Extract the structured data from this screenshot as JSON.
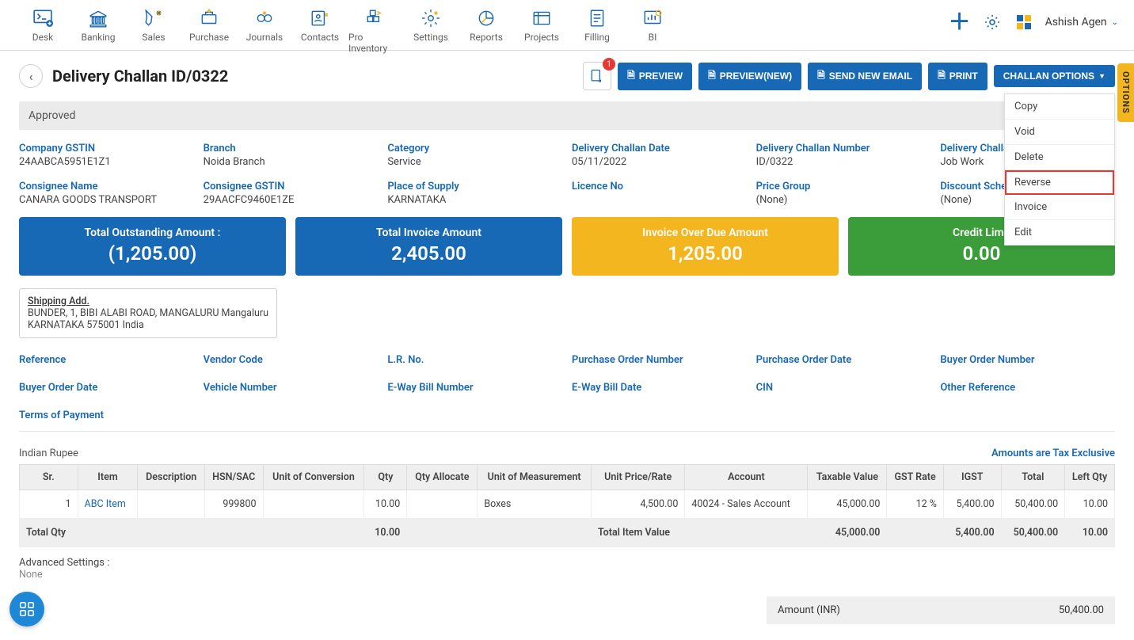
{
  "nav": {
    "items": [
      {
        "label": "Desk"
      },
      {
        "label": "Banking"
      },
      {
        "label": "Sales"
      },
      {
        "label": "Purchase"
      },
      {
        "label": "Journals"
      },
      {
        "label": "Contacts"
      },
      {
        "label": "Pro Inventory"
      },
      {
        "label": "Settings"
      },
      {
        "label": "Reports"
      },
      {
        "label": "Projects"
      },
      {
        "label": "Filling"
      },
      {
        "label": "BI"
      }
    ],
    "user": "Ashish Agen"
  },
  "header": {
    "title": "Delivery Challan ID/0322",
    "badge": "1",
    "actions": {
      "preview": "PREVIEW",
      "preview_new": "PREVIEW(NEW)",
      "send_email": "SEND NEW EMAIL",
      "print": "PRINT",
      "challan_options": "CHALLAN OPTIONS"
    },
    "options_menu": [
      "Copy",
      "Void",
      "Delete",
      "Reverse",
      "Invoice",
      "Edit"
    ],
    "status": "Approved"
  },
  "fields_top": [
    {
      "label": "Company GSTIN",
      "value": "24AABCA5951E1Z1"
    },
    {
      "label": "Branch",
      "value": "Noida Branch"
    },
    {
      "label": "Category",
      "value": "Service"
    },
    {
      "label": "Delivery Challan Date",
      "value": "05/11/2022"
    },
    {
      "label": "Delivery Challan Number",
      "value": "ID/0322"
    },
    {
      "label": "Delivery Challa",
      "value": "Job Work"
    },
    {
      "label": "Consignee Name",
      "value": "CANARA GOODS TRANSPORT"
    },
    {
      "label": "Consignee GSTIN",
      "value": "29AACFC9460E1ZE"
    },
    {
      "label": "Place of Supply",
      "value": "KARNATAKA"
    },
    {
      "label": "Licence No",
      "value": ""
    },
    {
      "label": "Price Group",
      "value": "(None)"
    },
    {
      "label": "Discount Sche",
      "value": "(None)"
    }
  ],
  "summary": [
    {
      "label": "Total Outstanding Amount :",
      "value": "(1,205.00)",
      "cls": "c-blue"
    },
    {
      "label": "Total Invoice Amount",
      "value": "2,405.00",
      "cls": "c-blue"
    },
    {
      "label": "Invoice Over Due Amount",
      "value": "1,205.00",
      "cls": "c-yellow"
    },
    {
      "label": "Credit Limit",
      "value": "0.00",
      "cls": "c-green"
    }
  ],
  "shipping": {
    "heading": "Shipping Add.",
    "line1": "BUNDER, 1, BIBI ALABI ROAD, MANGALURU Mangaluru",
    "line2": "KARNATAKA 575001 India"
  },
  "fields_mid": [
    {
      "label": "Reference"
    },
    {
      "label": "Vendor Code"
    },
    {
      "label": "L.R. No."
    },
    {
      "label": "Purchase Order Number"
    },
    {
      "label": "Purchase Order Date"
    },
    {
      "label": "Buyer Order Number"
    },
    {
      "label": "Buyer Order Date"
    },
    {
      "label": "Vehicle Number"
    },
    {
      "label": "E-Way Bill Number"
    },
    {
      "label": "E-Way Bill Date"
    },
    {
      "label": "CIN"
    },
    {
      "label": "Other Reference"
    },
    {
      "label": "Terms of Payment"
    }
  ],
  "currency": "Indian Rupee",
  "tax_note": "Amounts are Tax Exclusive",
  "table": {
    "headers": [
      "Sr.",
      "Item",
      "Description",
      "HSN/SAC",
      "Unit of Conversion",
      "Qty",
      "Qty Allocate",
      "Unit of Measurement",
      "Unit Price/Rate",
      "Account",
      "Taxable Value",
      "GST Rate",
      "IGST",
      "Total",
      "Left Qty"
    ],
    "row": {
      "sr": "1",
      "item": "ABC Item",
      "desc": "",
      "hsn": "999800",
      "uoc": "",
      "qty": "10.00",
      "qalloc": "",
      "uom": "Boxes",
      "rate": "4,500.00",
      "account": "40024 - Sales Account",
      "taxable": "45,000.00",
      "gstrate": "12 %",
      "igst": "5,400.00",
      "total": "50,400.00",
      "left": "10.00"
    },
    "footer": {
      "label": "Total Qty",
      "qty": "10.00",
      "ratelabel": "Total Item Value",
      "taxable": "45,000.00",
      "igst": "5,400.00",
      "total": "50,400.00",
      "left": "10.00"
    }
  },
  "advanced": {
    "label": "Advanced Settings :",
    "value": "None"
  },
  "amount": {
    "label": "Amount (INR)",
    "value": "50,400.00"
  },
  "options_tab": "OPTIONS"
}
